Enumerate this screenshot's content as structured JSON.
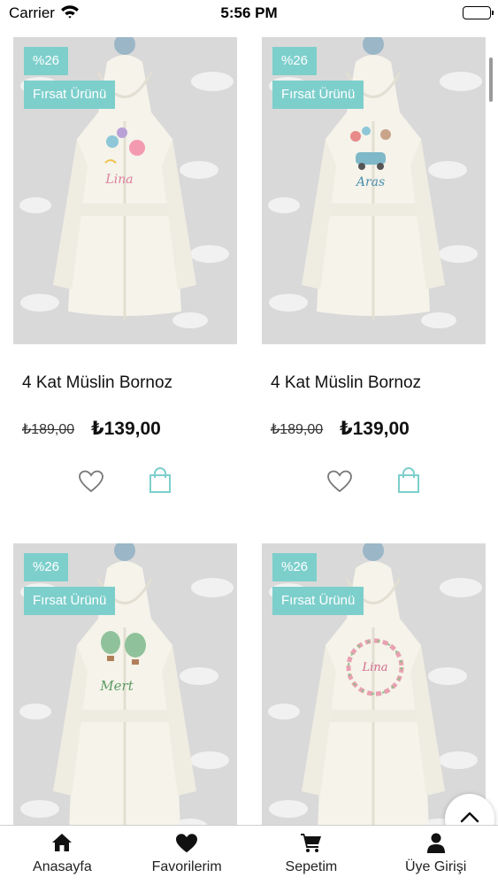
{
  "status_bar": {
    "carrier": "Carrier",
    "time": "5:56 PM"
  },
  "products": [
    {
      "discount": "%26",
      "deal_label": "Fırsat Ürünü",
      "title": "4 Kat Müslin Bornoz",
      "old_price": "₺189,00",
      "price": "₺139,00",
      "embroidery_name": "Lina"
    },
    {
      "discount": "%26",
      "deal_label": "Fırsat Ürünü",
      "title": "4 Kat Müslin Bornoz",
      "old_price": "₺189,00",
      "price": "₺139,00",
      "embroidery_name": "Aras"
    },
    {
      "discount": "%26",
      "deal_label": "Fırsat Ürünü",
      "title": "",
      "old_price": "",
      "price": "",
      "embroidery_name": "Mert"
    },
    {
      "discount": "%26",
      "deal_label": "Fırsat Ürünü",
      "title": "",
      "old_price": "",
      "price": "",
      "embroidery_name": "Lina"
    }
  ],
  "tab_bar": {
    "items": [
      {
        "label": "Anasayfa",
        "icon": "home-icon"
      },
      {
        "label": "Favorilerim",
        "icon": "heart-icon"
      },
      {
        "label": "Sepetim",
        "icon": "cart-icon"
      },
      {
        "label": "Üye Girişi",
        "icon": "user-icon"
      }
    ]
  },
  "colors": {
    "badge": "#7dcfcc",
    "accent": "#7dcfcc",
    "photo_background": "#d8d8d8"
  }
}
